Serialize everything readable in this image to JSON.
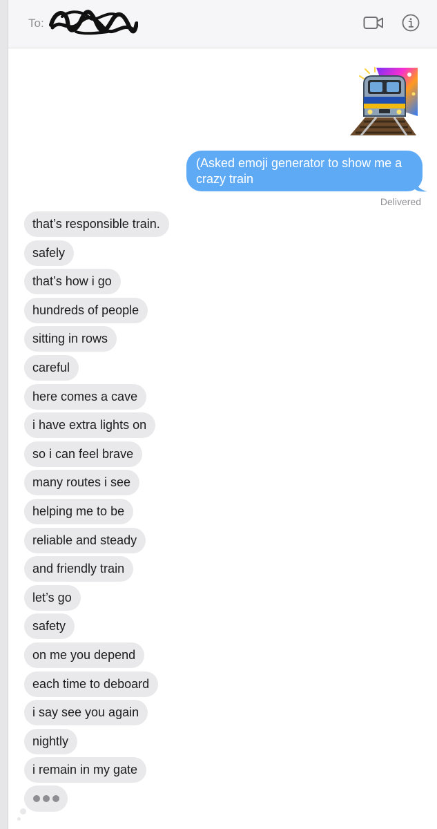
{
  "header": {
    "to_label": "To:",
    "recipient": "",
    "video_icon": "video-camera-icon",
    "info_icon": "info-icon"
  },
  "sent": {
    "sticker_icon": "train-sticker",
    "message": "(Asked emoji generator to show me a crazy train",
    "status": "Delivered",
    "bubble_color": "#5faaf5"
  },
  "received": {
    "bubble_color": "#e9e9eb",
    "messages": [
      "that’s responsible train.",
      "safely",
      "that’s how i go",
      "hundreds of people",
      "sitting in rows",
      "careful",
      "here comes a cave",
      "i have extra lights on",
      "so i can feel brave",
      "many routes i see",
      "helping me to be",
      "reliable and steady",
      "and friendly train",
      "let’s go",
      "safety",
      "on me you depend",
      "each time to deboard",
      "i say see you again",
      "nightly",
      "i remain in my gate"
    ]
  },
  "typing_indicator": "typing-dots"
}
